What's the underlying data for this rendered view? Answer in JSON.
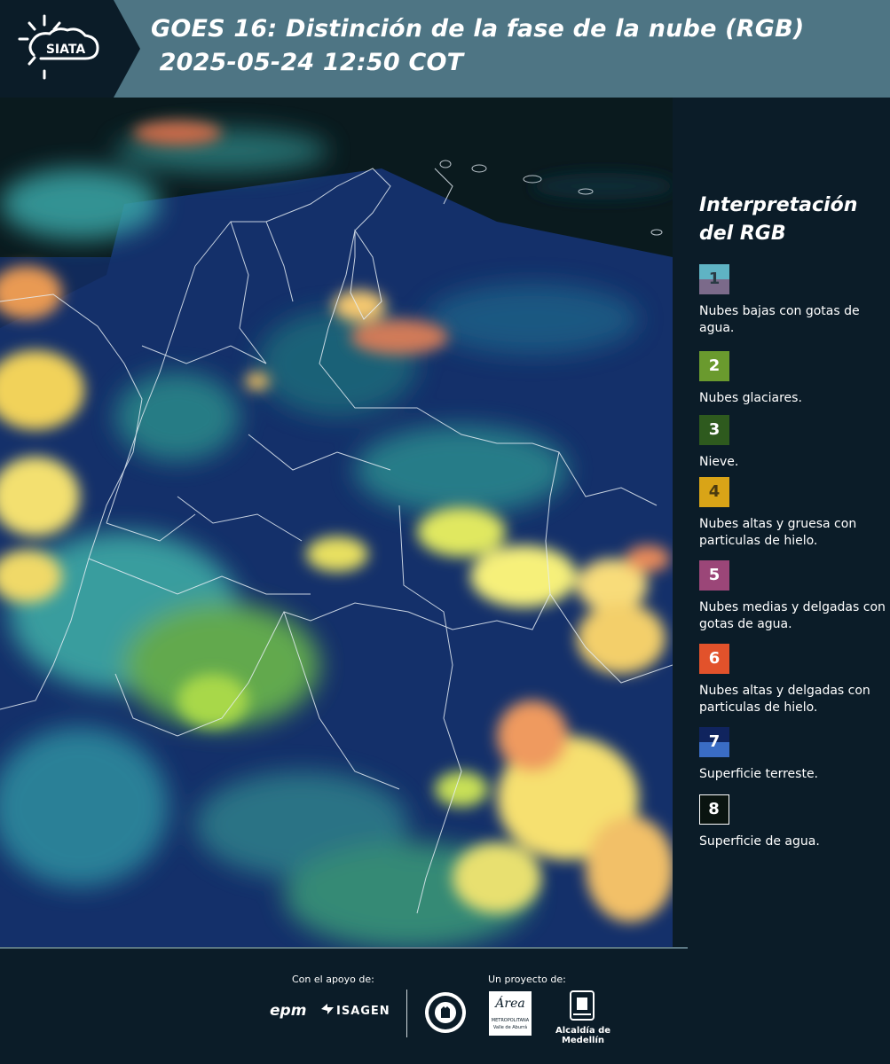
{
  "header": {
    "logo_text": "SIATA",
    "title_line1": "GOES 16: Distinción de la fase de la nube (RGB)",
    "title_line2": " 2025-05-24 12:50 COT"
  },
  "legend": {
    "title": "Interpretación del RGB",
    "items": [
      {
        "num": "1",
        "label": "Nubes bajas con gotas de agua.",
        "color_top": "#5fb3c4",
        "color_bottom": "#7b6a8a"
      },
      {
        "num": "2",
        "label": "Nubes glaciares.",
        "color": "#6a9a2e"
      },
      {
        "num": "3",
        "label": "Nieve.",
        "color": "#2e5a1e"
      },
      {
        "num": "4",
        "label": "Nubes altas y gruesa con particulas de hielo.",
        "color": "#d9a417"
      },
      {
        "num": "5",
        "label": "Nubes medias y delgadas con gotas de agua.",
        "color": "#9b4678"
      },
      {
        "num": "6",
        "label": "Nubes altas y delgadas con particulas de hielo.",
        "color": "#e2522b"
      },
      {
        "num": "7",
        "label": "Superficie terreste.",
        "color_top": "#10245e",
        "color_bottom": "#3a6cc4"
      },
      {
        "num": "8",
        "label": "Superficie de agua.",
        "color": "#0a1410"
      }
    ]
  },
  "footer": {
    "support_label": "Con el apoyo de:",
    "project_label": "Un proyecto de:",
    "brand_epm": "epm",
    "brand_isagen": "ISAGEN",
    "brand_area_line1": "Área",
    "brand_area_line2": "METROPOLITANA",
    "brand_area_line3": "Valle de Aburrá",
    "brand_alcaldia": "Alcaldía de Medellín"
  }
}
